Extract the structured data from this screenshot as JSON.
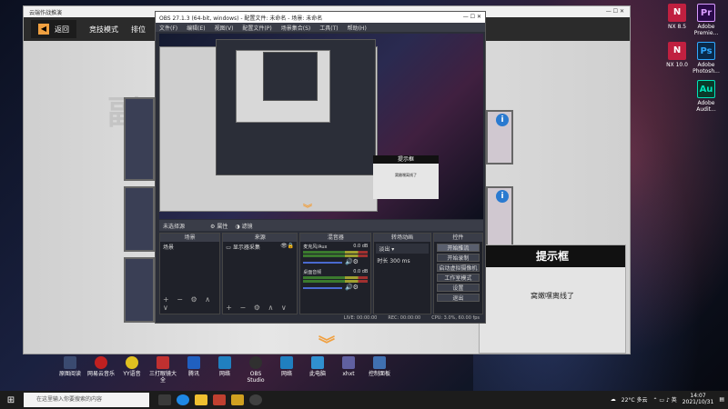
{
  "desktop": {
    "icons": [
      {
        "label": "NX 8.5",
        "glyph": "N",
        "color": "#c02040"
      },
      {
        "label": "Adobe Premie...",
        "glyph": "Pr",
        "color": "#2a0a4a"
      },
      {
        "label": "NX 10.0",
        "glyph": "N",
        "color": "#c02040"
      },
      {
        "label": "Adobe Photosh...",
        "glyph": "Ps",
        "color": "#0a2a4a"
      },
      {
        "label": "Adobe Audit...",
        "glyph": "Au",
        "color": "#0a3a2a"
      }
    ],
    "bottom_icons": [
      "原图阅读",
      "网易云音乐",
      "YY语音",
      "三打眼镜大全",
      "腾讯",
      "网络",
      "OBS Studio",
      "网络",
      "此电脑",
      "xhxt",
      "控制面板"
    ]
  },
  "game": {
    "title": "云端作战推演",
    "back_label": "返回",
    "tabs": [
      "竞技模式",
      "排位"
    ],
    "big_char": "副",
    "hint_title": "提示框",
    "hint_message": "窝嫩嘿离线了",
    "accent_color": "#f0a040"
  },
  "obs": {
    "title": "OBS 27.1.3 (64-bit, windows) - 配置文件: 未命名 - 场景: 未命名",
    "menu": [
      "文件(F)",
      "编辑(E)",
      "视图(V)",
      "配置文件(P)",
      "场景集合(S)",
      "工具(T)",
      "帮助(H)"
    ],
    "no_source": "未选择源",
    "source_bar": [
      "属性",
      "滤镜"
    ],
    "docks": {
      "scenes": {
        "header": "场景",
        "items": [
          "场景"
        ]
      },
      "sources": {
        "header": "来源",
        "items": [
          "显示器采集"
        ]
      },
      "mixer": {
        "header": "混音器",
        "tracks": [
          {
            "name": "麦克风/Aux",
            "db": "0.0 dB"
          },
          {
            "name": "桌面音频",
            "db": "0.0 dB"
          }
        ]
      },
      "transitions": {
        "header": "转场动画",
        "type": "淡出",
        "duration_label": "时长",
        "duration": "300 ms"
      },
      "controls": {
        "header": "控件",
        "buttons": [
          "开始推流",
          "开始录制",
          "启动虚拟摄像机",
          "工作室模式",
          "设置",
          "退出"
        ]
      }
    },
    "status": {
      "live": "LIVE: 00:00:00",
      "rec": "REC: 00:00:00",
      "cpu": "CPU: 3.0%, 60.00 fps"
    }
  },
  "taskbar": {
    "search_placeholder": "在这里输入你要搜索的内容",
    "weather": "22°C 多云",
    "time": "14:07",
    "date": "2021/10/31"
  }
}
